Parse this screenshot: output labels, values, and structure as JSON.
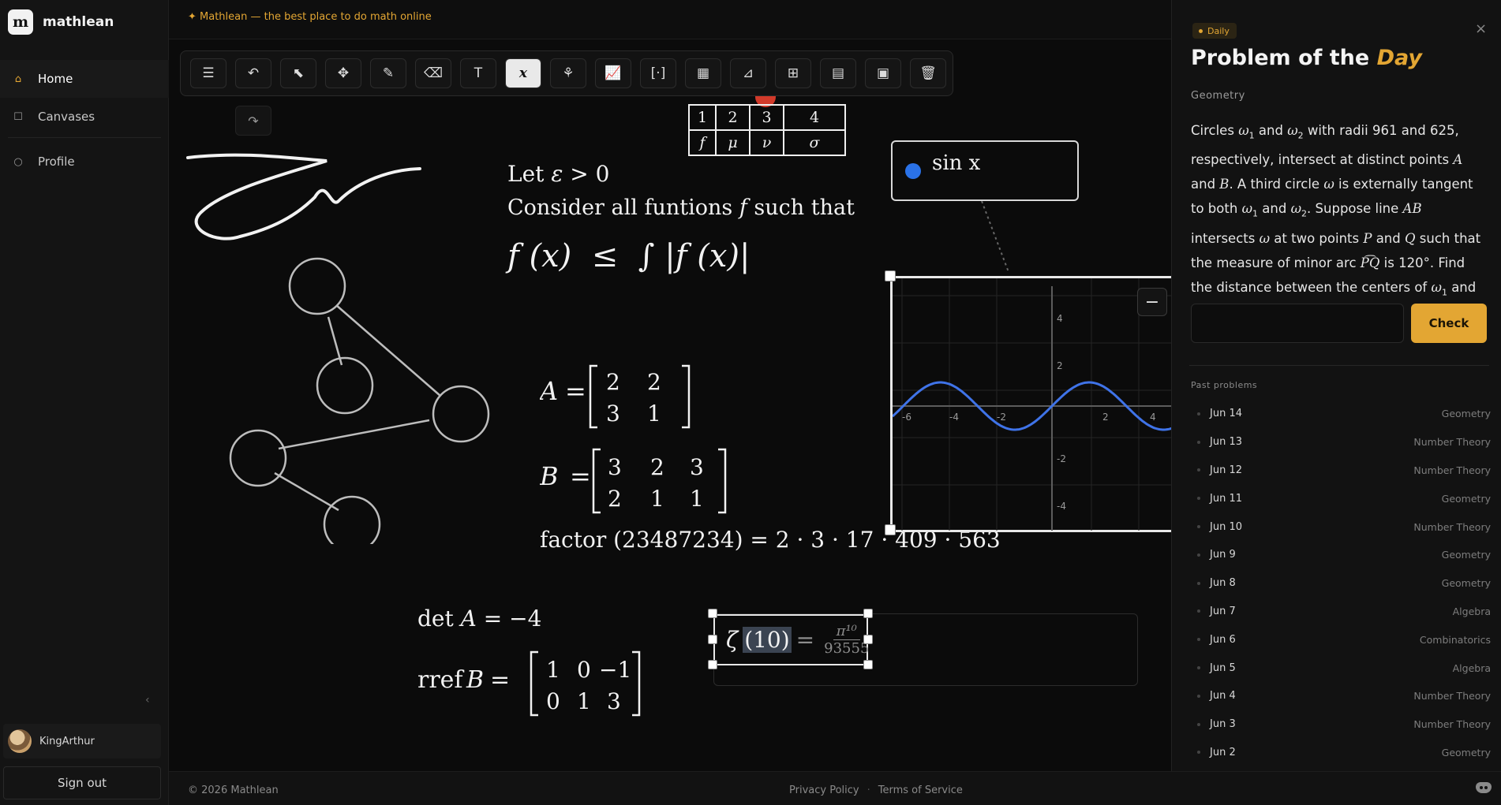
{
  "app": {
    "name": "mathlean",
    "logo_text": "m",
    "tagline": "✦ Mathlean — the best place to do math online"
  },
  "sidebar": {
    "items": [
      {
        "label": "Home",
        "icon": "home-icon",
        "active": true
      },
      {
        "label": "Canvases",
        "icon": "square-icon",
        "active": false
      },
      {
        "label": "Profile",
        "icon": "circle-icon",
        "active": false
      }
    ],
    "collapse_glyph": "‹",
    "user": {
      "name": "KingArthur"
    },
    "signout_label": "Sign out"
  },
  "toolbar": {
    "tools": [
      {
        "name": "menu",
        "glyph": "☰"
      },
      {
        "name": "undo",
        "glyph": "↶"
      },
      {
        "name": "select",
        "glyph": "⬉"
      },
      {
        "name": "move",
        "glyph": "✥"
      },
      {
        "name": "pen",
        "glyph": "✎"
      },
      {
        "name": "eraser",
        "glyph": "⌫"
      },
      {
        "name": "text",
        "glyph": "T"
      },
      {
        "name": "math",
        "glyph": "x",
        "active": true
      },
      {
        "name": "graph-tree",
        "glyph": "⚘"
      },
      {
        "name": "plot",
        "glyph": "📈"
      },
      {
        "name": "matrix",
        "glyph": "[·]"
      },
      {
        "name": "table",
        "glyph": "▦"
      },
      {
        "name": "geometry",
        "glyph": "⊿"
      },
      {
        "name": "grid",
        "glyph": "⊞"
      },
      {
        "name": "notes",
        "glyph": "▤"
      },
      {
        "name": "document",
        "glyph": "▣"
      },
      {
        "name": "delete",
        "glyph": "🗑"
      }
    ],
    "redo_glyph": "↷"
  },
  "canvas": {
    "table": {
      "rows": [
        [
          "1",
          "2",
          "3",
          "4"
        ],
        [
          "f",
          "μ",
          "ν",
          "σ"
        ]
      ]
    },
    "let_line": {
      "prefix": "Let ",
      "var": "ε",
      "rest": " > 0"
    },
    "consider_line": {
      "prefix": "Consider all funtions ",
      "var": "f",
      "rest": " such that"
    },
    "inequality": "f (x)  ≤  ∫ |f (x)|",
    "matrix_a": {
      "name": "A",
      "rows": [
        [
          "2",
          "2"
        ],
        [
          "3",
          "1"
        ]
      ]
    },
    "matrix_b": {
      "name": "B",
      "rows": [
        [
          "3",
          "2",
          "3"
        ],
        [
          "2",
          "1",
          "1"
        ]
      ]
    },
    "factor": {
      "prefix": "factor (23487234) = ",
      "result": "2 · 3 · 17 · 409 · 563"
    },
    "det": {
      "prefix": "det ",
      "var": "A",
      "rest": " = −4"
    },
    "rref": {
      "prefix": "rref ",
      "var": "B",
      "eq": " = ",
      "rows": [
        [
          "1",
          "0",
          "−1"
        ],
        [
          "0",
          "1",
          "3"
        ]
      ]
    },
    "sin_label": "sin x",
    "zeta": {
      "fn": "ζ",
      "arg": "(10)",
      "eq": "=",
      "num": "π¹⁰",
      "den": "93555"
    },
    "graph": {
      "x_ticks": [
        "-6",
        "-4",
        "-2",
        "2",
        "4"
      ],
      "y_ticks": [
        "4",
        "2",
        "-2",
        "-4"
      ],
      "curve_color": "#3f73e8",
      "minus_glyph": "−"
    }
  },
  "footer": {
    "copyright": "© 2026 Mathlean",
    "links": [
      "Privacy Policy",
      "Terms of Service"
    ],
    "separator": "·"
  },
  "panel": {
    "badge": "Daily",
    "close_glyph": "×",
    "title_prefix": "Problem of the ",
    "title_accent": "Day",
    "category": "Geometry",
    "answer_value": "",
    "check_label": "Check",
    "past_title": "Past problems",
    "past": [
      {
        "date": "Jun 14",
        "category": "Geometry"
      },
      {
        "date": "Jun 13",
        "category": "Number Theory"
      },
      {
        "date": "Jun 12",
        "category": "Number Theory"
      },
      {
        "date": "Jun 11",
        "category": "Geometry"
      },
      {
        "date": "Jun 10",
        "category": "Number Theory"
      },
      {
        "date": "Jun 9",
        "category": "Geometry"
      },
      {
        "date": "Jun 8",
        "category": "Geometry"
      },
      {
        "date": "Jun 7",
        "category": "Algebra"
      },
      {
        "date": "Jun 6",
        "category": "Combinatorics"
      },
      {
        "date": "Jun 5",
        "category": "Algebra"
      },
      {
        "date": "Jun 4",
        "category": "Number Theory"
      },
      {
        "date": "Jun 3",
        "category": "Number Theory"
      },
      {
        "date": "Jun 2",
        "category": "Geometry"
      }
    ]
  },
  "colors": {
    "accent": "#e3a633",
    "plot_blue": "#3f73e8"
  }
}
